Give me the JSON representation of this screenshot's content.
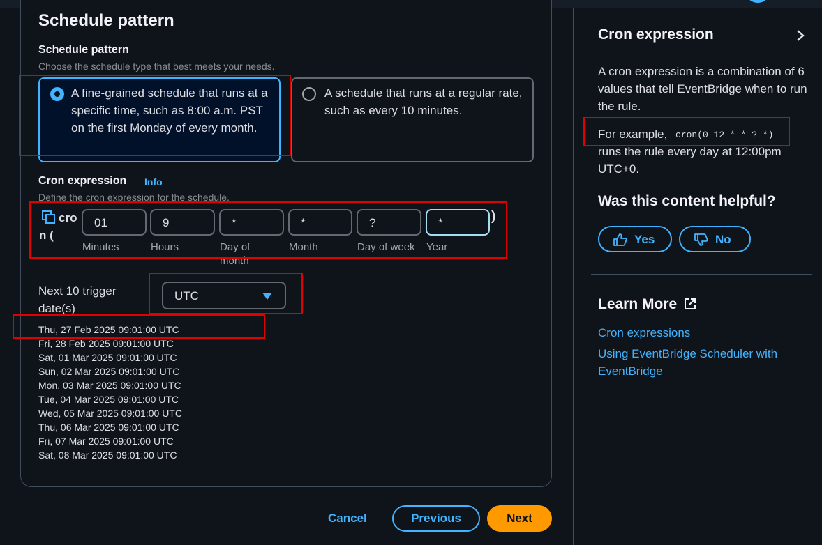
{
  "main": {
    "section_title": "Schedule pattern",
    "field_label": "Schedule pattern",
    "field_desc": "Choose the schedule type that best meets your needs.",
    "options": [
      {
        "label": "A fine-grained schedule that runs at a specific time, such as 8:00 a.m. PST on the first Monday of every month.",
        "selected": true
      },
      {
        "label": "A schedule that runs at a regular rate, such as every 10 minutes.",
        "selected": false
      }
    ],
    "cron": {
      "label": "Cron expression",
      "info": "Info",
      "desc": "Define the cron expression for the schedule.",
      "prefix": "cron (",
      "suffix": ")",
      "fields": [
        {
          "value": "01",
          "label": "Minutes"
        },
        {
          "value": "9",
          "label": "Hours"
        },
        {
          "value": "*",
          "label": "Day of month"
        },
        {
          "value": "*",
          "label": "Month"
        },
        {
          "value": "?",
          "label": "Day of week"
        },
        {
          "value": "*",
          "label": "Year"
        }
      ]
    },
    "trigger": {
      "label": "Next 10 trigger date(s)",
      "timezone": "UTC",
      "dates": [
        "Thu, 27 Feb 2025 09:01:00 UTC",
        "Fri, 28 Feb 2025 09:01:00 UTC",
        "Sat, 01 Mar 2025 09:01:00 UTC",
        "Sun, 02 Mar 2025 09:01:00 UTC",
        "Mon, 03 Mar 2025 09:01:00 UTC",
        "Tue, 04 Mar 2025 09:01:00 UTC",
        "Wed, 05 Mar 2025 09:01:00 UTC",
        "Thu, 06 Mar 2025 09:01:00 UTC",
        "Fri, 07 Mar 2025 09:01:00 UTC",
        "Sat, 08 Mar 2025 09:01:00 UTC"
      ]
    }
  },
  "footer": {
    "cancel": "Cancel",
    "previous": "Previous",
    "next": "Next"
  },
  "help_panel": {
    "title": "Cron expression",
    "body": "A cron expression is a combination of 6 values that tell EventBridge when to run the rule.",
    "example_prefix": "For example,",
    "example_code": "cron(0 12 * * ? *)",
    "example_suffix": "runs the rule every day at 12:00pm UTC+0.",
    "feedback_question": "Was this content helpful?",
    "yes": "Yes",
    "no": "No",
    "learn_more": "Learn More",
    "links": [
      "Cron expressions",
      "Using EventBridge Scheduler with EventBridge"
    ]
  },
  "colors": {
    "accent": "#42b4ff",
    "primary_button": "#ff9900",
    "background": "#0f141a",
    "highlight_box": "#e00000"
  }
}
